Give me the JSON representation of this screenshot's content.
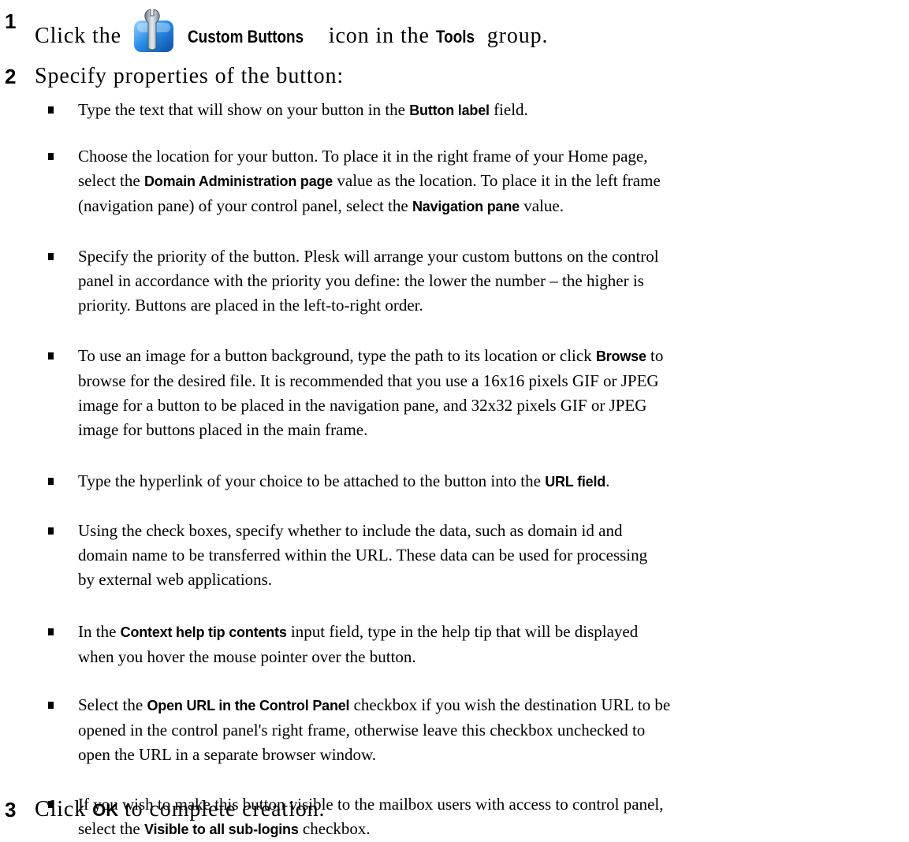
{
  "steps": [
    {
      "number": "1",
      "pre": "Click the",
      "icon": "custom-buttons-wrench-icon",
      "ui1": "Custom Buttons",
      "mid": "icon in the",
      "ui2": "Tools",
      "post": "group."
    },
    {
      "number": "2",
      "text": "Specify properties of the button:"
    },
    {
      "number": "3",
      "pre": "Click",
      "ui1": "OK",
      "post": "to complete creation."
    }
  ],
  "bullets": [
    {
      "lines": [
        [
          "Type the text that will show on your button in the ",
          {
            "b": "Button label"
          },
          " field."
        ]
      ]
    },
    {
      "lines": [
        [
          "Choose the location for your button. To place it in the right frame of your Home page,"
        ],
        [
          "select the ",
          {
            "b": "Domain Administration page"
          },
          " value as the location. To place it in the left frame"
        ],
        [
          "(navigation pane) of your control panel, select the ",
          {
            "b": "Navigation pane"
          },
          " value."
        ]
      ]
    },
    {
      "lines": [
        [
          "Specify the priority of the button. Plesk will arrange your custom buttons on the control"
        ],
        [
          "panel in accordance with the priority you define: the lower the number – the higher is"
        ],
        [
          "priority. Buttons are placed in the left-to-right order."
        ]
      ]
    },
    {
      "lines": [
        [
          "To use an image for a button background, type the path to its location or click ",
          {
            "b": "Browse"
          },
          " to"
        ],
        [
          "browse for the desired file. It is recommended that you use a 16x16 pixels GIF or JPEG"
        ],
        [
          "image for a button to be placed in the navigation pane, and 32x32 pixels GIF or JPEG"
        ],
        [
          "image for buttons placed in the main frame."
        ]
      ]
    },
    {
      "lines": [
        [
          "Type the hyperlink of your choice to be attached to the button into the ",
          {
            "b": "URL field"
          },
          "."
        ]
      ]
    },
    {
      "lines": [
        [
          "Using the check boxes, specify whether to include the data, such as domain id and"
        ],
        [
          "domain name to be transferred within the URL. These data can be used for processing"
        ],
        [
          "by external web applications."
        ]
      ]
    },
    {
      "lines": [
        [
          "In the ",
          {
            "b": "Context help tip contents"
          },
          " input field, type in the help tip that will be displayed"
        ],
        [
          "when you hover the mouse pointer over the button."
        ]
      ]
    },
    {
      "lines": [
        [
          "Select the ",
          {
            "b": "Open URL in the Control Panel"
          },
          " checkbox if you wish the destination URL to be"
        ],
        [
          "opened in the control panel's right frame, otherwise leave this checkbox unchecked to"
        ],
        [
          "open the URL in a separate browser window."
        ]
      ]
    },
    {
      "lines": [
        [
          "If you wish to make this button visible to the mailbox users with access to control panel,"
        ],
        [
          "select the ",
          {
            "b": "Visible to all sub-logins"
          },
          " checkbox."
        ]
      ]
    }
  ]
}
